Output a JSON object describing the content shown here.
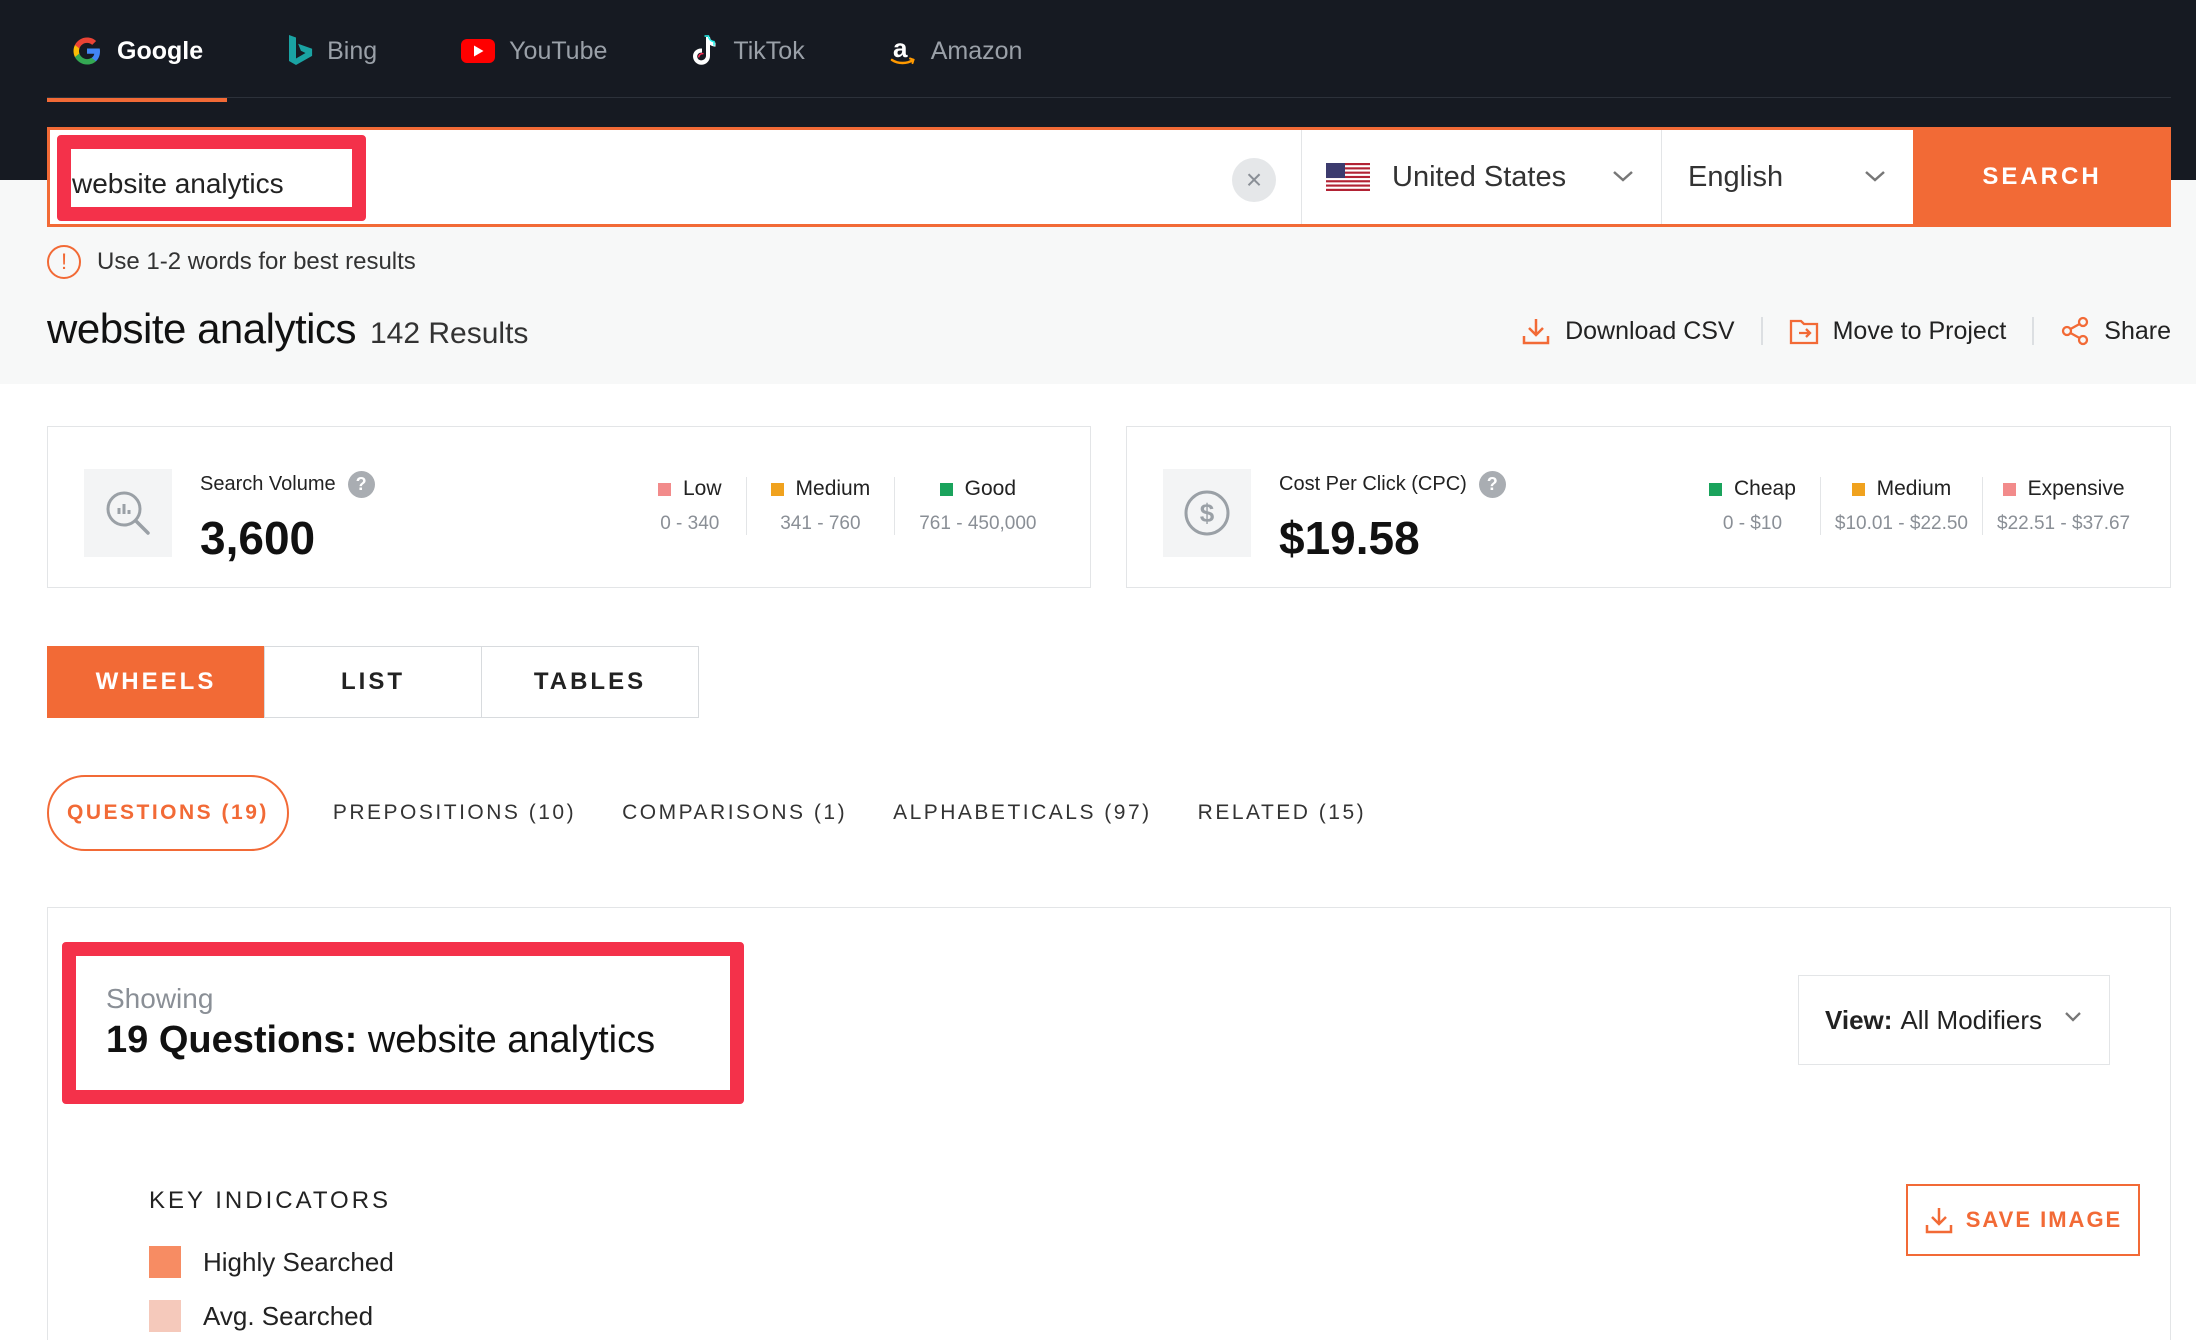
{
  "engines": [
    {
      "label": "Google",
      "icon": "google-icon",
      "active": true
    },
    {
      "label": "Bing",
      "icon": "bing-icon"
    },
    {
      "label": "YouTube",
      "icon": "youtube-icon"
    },
    {
      "label": "TikTok",
      "icon": "tiktok-icon"
    },
    {
      "label": "Amazon",
      "icon": "amazon-icon"
    }
  ],
  "search": {
    "value": "website analytics",
    "clear_icon": "×",
    "country": "United States",
    "language": "English",
    "button_label": "SEARCH"
  },
  "hint": {
    "icon": "!",
    "text": "Use 1-2 words for best results"
  },
  "results": {
    "keyword": "website analytics",
    "count_label": "142 Results"
  },
  "actions": {
    "download_csv": "Download CSV",
    "move_to_project": "Move to Project",
    "share": "Share"
  },
  "search_volume": {
    "label": "Search Volume",
    "help": "?",
    "value": "3,600",
    "legend": [
      {
        "name": "Low",
        "range": "0 - 340",
        "color": "#f28b8b"
      },
      {
        "name": "Medium",
        "range": "341 - 760",
        "color": "#f0a21e"
      },
      {
        "name": "Good",
        "range": "761 - 450,000",
        "color": "#1aa35c"
      }
    ]
  },
  "cpc": {
    "label": "Cost Per Click (CPC)",
    "help": "?",
    "value": "$19.58",
    "legend": [
      {
        "name": "Cheap",
        "range": "0 - $10",
        "color": "#1aa35c"
      },
      {
        "name": "Medium",
        "range": "$10.01 - $22.50",
        "color": "#f0a21e"
      },
      {
        "name": "Expensive",
        "range": "$22.51 - $37.67",
        "color": "#f28b8b"
      }
    ]
  },
  "view_modes": [
    "WHEELS",
    "LIST",
    "TABLES"
  ],
  "categories": [
    "QUESTIONS (19)",
    "PREPOSITIONS (10)",
    "COMPARISONS (1)",
    "ALPHABETICALS (97)",
    "RELATED (15)"
  ],
  "panel": {
    "showing_label": "Showing",
    "heading_bold": "19 Questions:",
    "heading_rest": " website analytics",
    "view_label": "View:",
    "view_value": "All Modifiers",
    "key_title": "KEY INDICATORS",
    "key_items": [
      {
        "label": "Highly Searched",
        "color": "#f78c63"
      },
      {
        "label": "Avg. Searched",
        "color": "#f5c9bb"
      }
    ],
    "save_image": "SAVE IMAGE"
  },
  "colors": {
    "accent": "#f26a36",
    "highlight": "#f4314a",
    "header_bg": "#161a22"
  }
}
